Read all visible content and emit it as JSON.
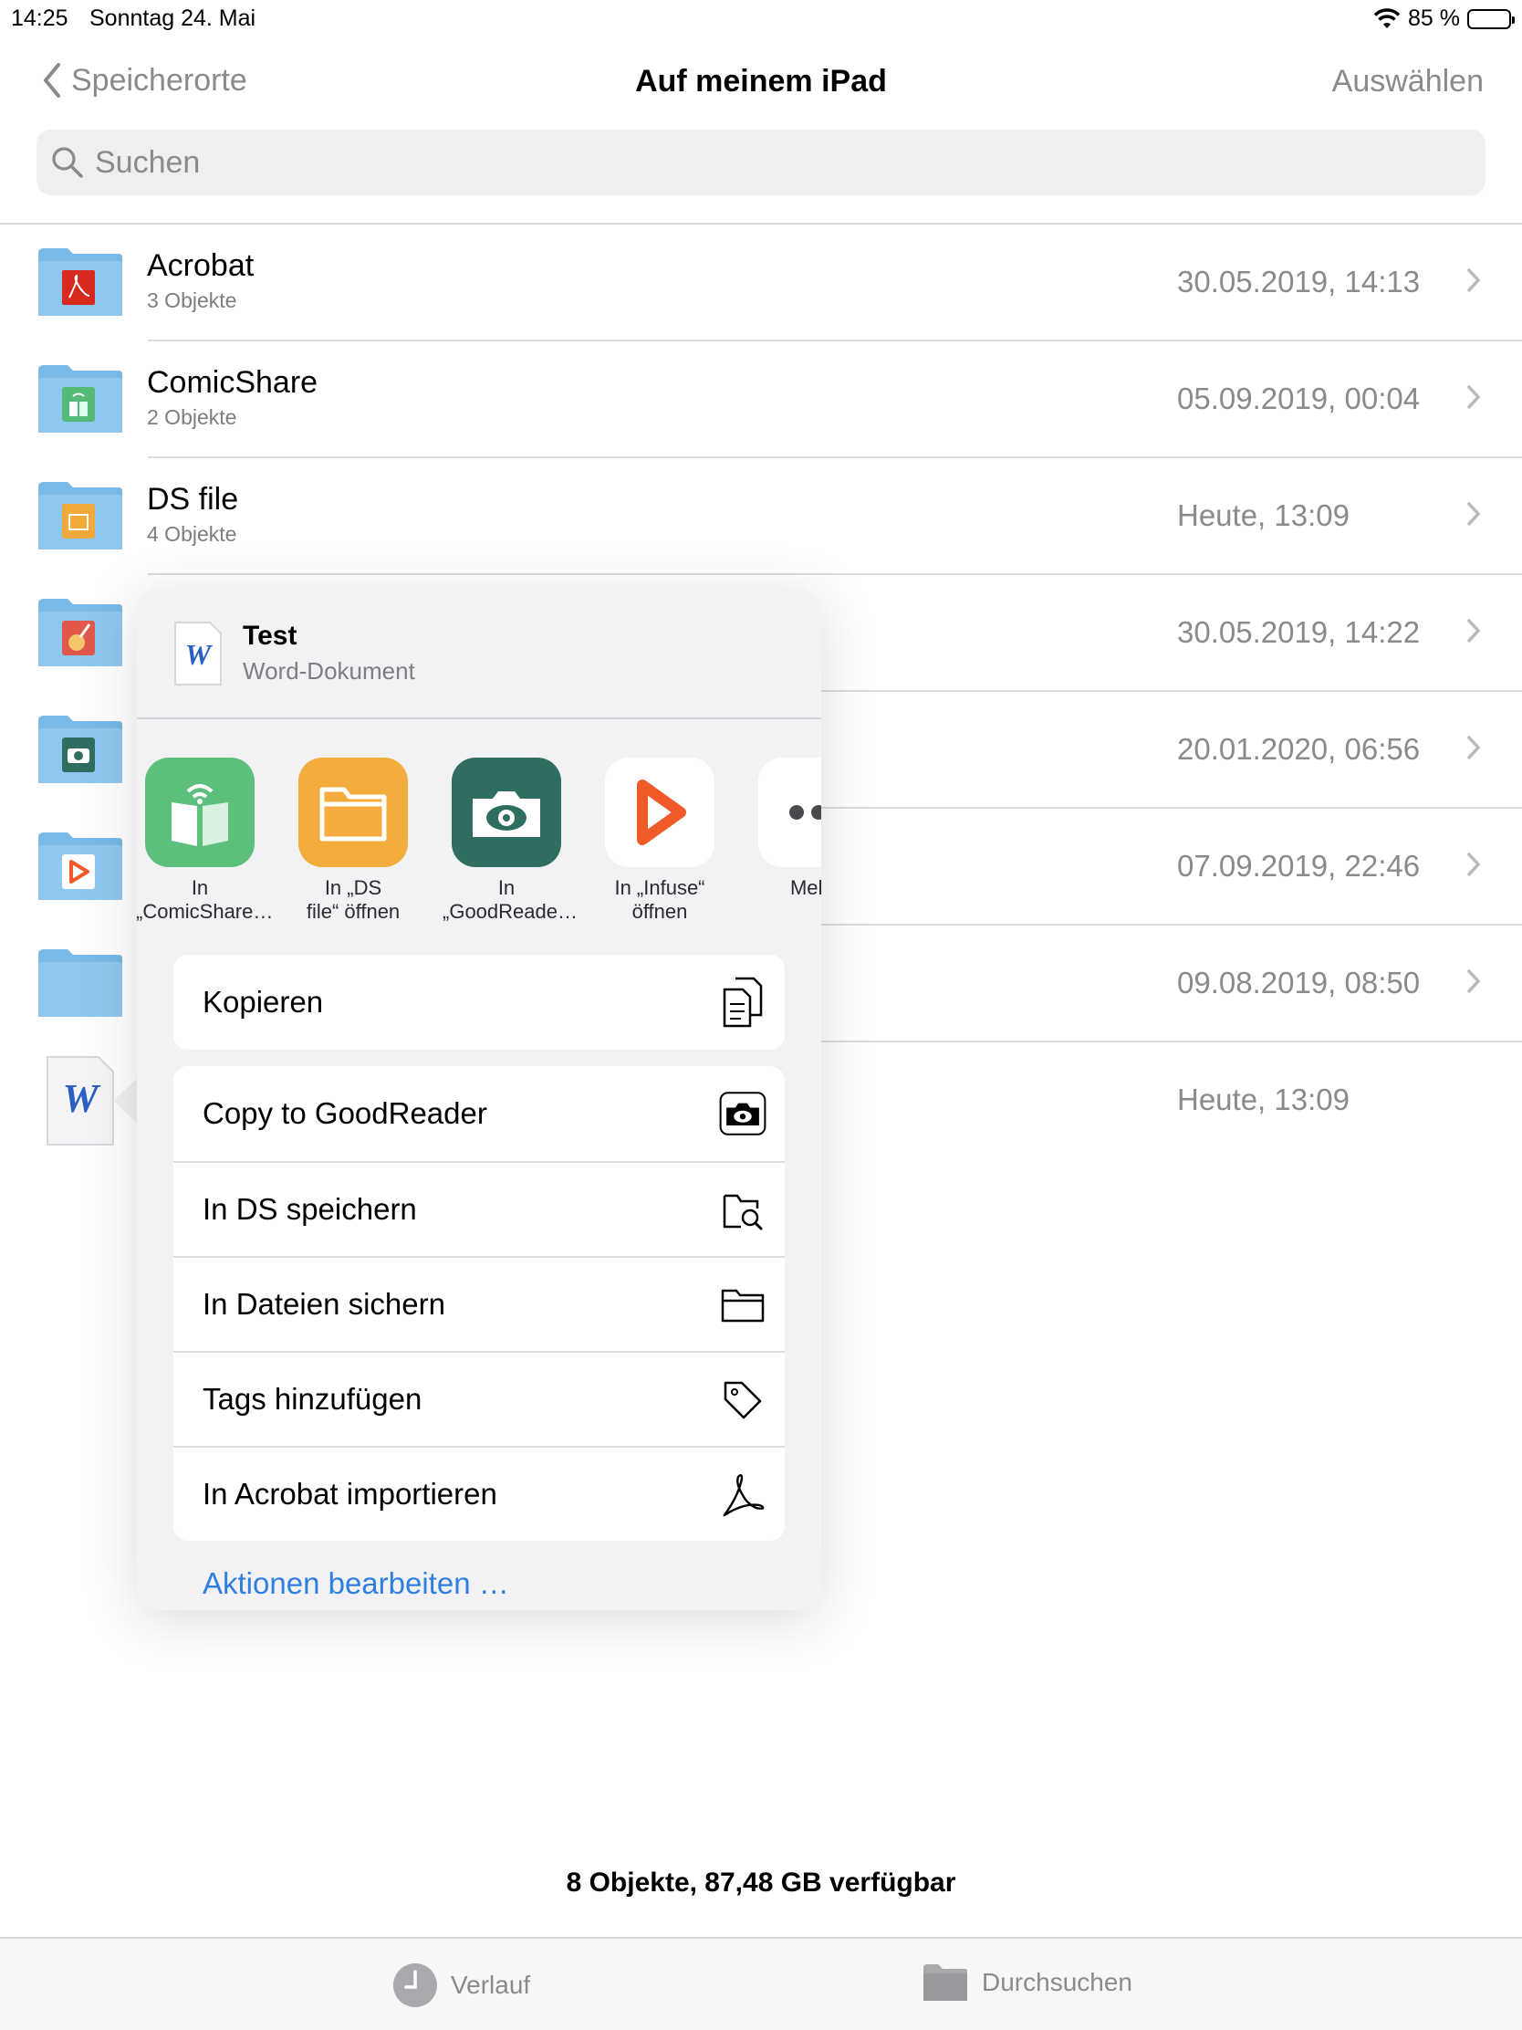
{
  "status": {
    "time": "14:25",
    "date": "Sonntag 24. Mai",
    "battery": "85 %",
    "battery_level": 0.85
  },
  "nav": {
    "back": "Speicherorte",
    "title": "Auf meinem iPad",
    "select": "Auswählen"
  },
  "search": {
    "placeholder": "Suchen"
  },
  "files": [
    {
      "name": "Acrobat",
      "sub": "3 Objekte",
      "date": "30.05.2019, 14:13",
      "icon": "acrobat-folder-icon"
    },
    {
      "name": "ComicShare",
      "sub": "2 Objekte",
      "date": "05.09.2019, 00:04",
      "icon": "comicshare-folder-icon"
    },
    {
      "name": "DS file",
      "sub": "4 Objekte",
      "date": "Heute, 13:09",
      "icon": "dsfile-folder-icon"
    },
    {
      "name": "",
      "sub": "",
      "date": "30.05.2019, 14:22",
      "icon": "garageband-folder-icon"
    },
    {
      "name": "",
      "sub": "",
      "date": "20.01.2020, 06:56",
      "icon": "goodreader-folder-icon"
    },
    {
      "name": "",
      "sub": "",
      "date": "07.09.2019, 22:46",
      "icon": "infuse-folder-icon"
    },
    {
      "name": "",
      "sub": "",
      "date": "09.08.2019, 08:50",
      "icon": "folder-icon"
    },
    {
      "name": "",
      "sub": "",
      "date": "Heute, 13:09",
      "icon": "word-document-icon"
    }
  ],
  "popover": {
    "doc_title": "Test",
    "doc_type": "Word-Dokument",
    "apps": [
      {
        "label": "In\n„ComicShare…",
        "icon": "comicshare-app-icon"
      },
      {
        "label": "In „DS\nfile“ öffnen",
        "icon": "dsfile-app-icon"
      },
      {
        "label": "In\n„GoodReade…",
        "icon": "goodreader-app-icon"
      },
      {
        "label": "In „Infuse“\nöffnen",
        "icon": "infuse-app-icon"
      },
      {
        "label": "Mehr",
        "icon": "more-icon"
      }
    ],
    "copy": "Kopieren",
    "actions": [
      {
        "label": "Copy to GoodReader",
        "icon": "goodreader-icon"
      },
      {
        "label": "In DS speichern",
        "icon": "ds-save-icon"
      },
      {
        "label": "In Dateien sichern",
        "icon": "folder-icon"
      },
      {
        "label": "Tags hinzufügen",
        "icon": "tag-icon"
      },
      {
        "label": "In Acrobat importieren",
        "icon": "acrobat-icon"
      }
    ],
    "edit": "Aktionen bearbeiten …"
  },
  "footer": {
    "count": "8 Objekte, 87,48 GB verfügbar"
  },
  "tabbar": {
    "recent": "Verlauf",
    "browse": "Durchsuchen"
  },
  "colors": {
    "accent": "#2f7fe0",
    "folder": "#8cc5ee",
    "gray_text": "#8a8a8e"
  }
}
